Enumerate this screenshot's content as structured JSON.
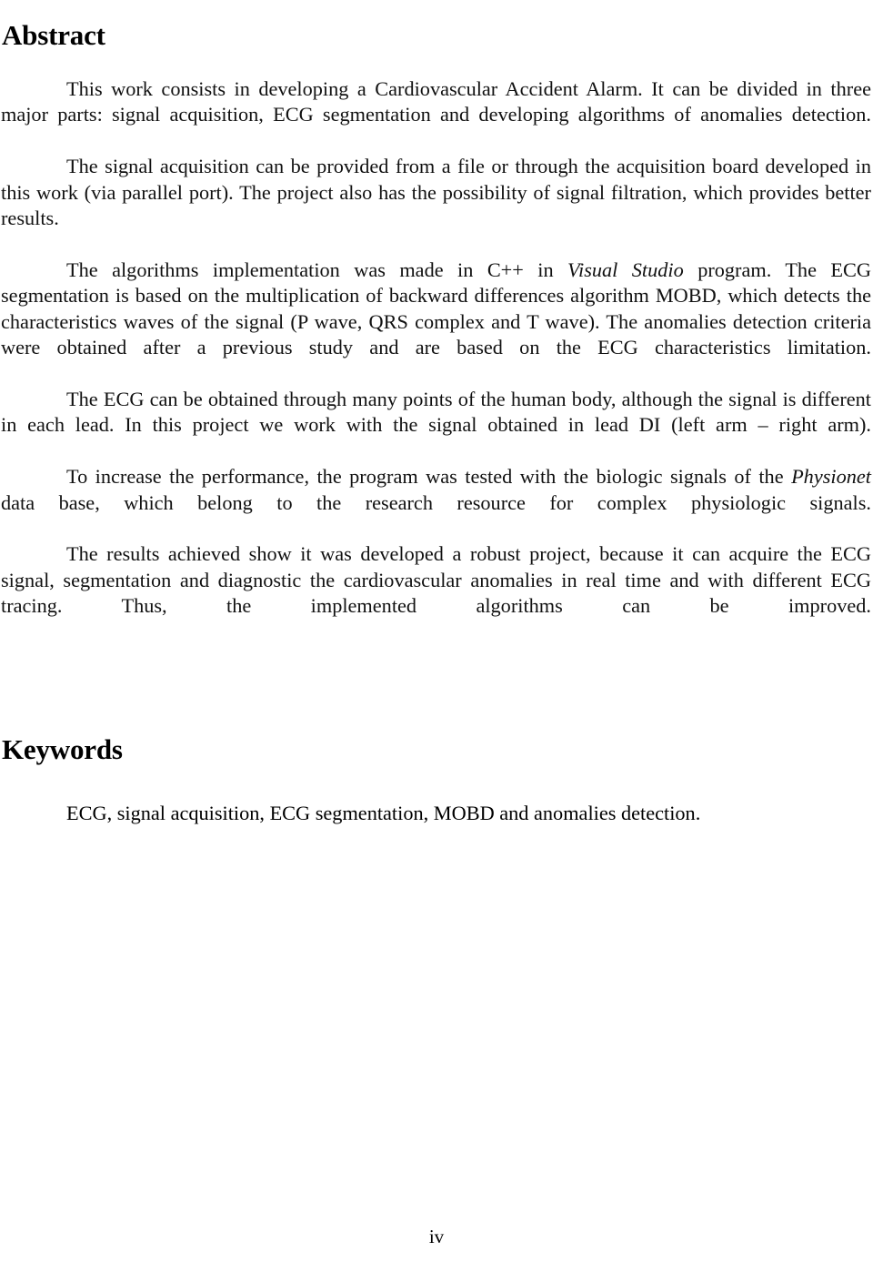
{
  "document": {
    "page_number": "iv",
    "sections": [
      {
        "heading": "Abstract",
        "paragraphs": [
          {
            "parts": [
              {
                "text": "This work consists in developing a Cardiovascular Accident Alarm. It can be divided in three major parts: signal acquisition, ECG segmentation and developing algorithms of anomalies detection.",
                "style": "normal"
              }
            ]
          },
          {
            "parts": [
              {
                "text": "The signal acquisition can be provided from a file or through the acquisition board developed in this work (via parallel port). The project also has the possibility of signal filtration, which provides better results.",
                "style": "normal"
              }
            ]
          },
          {
            "parts": [
              {
                "text": "The algorithms implementation was made in C++ in ",
                "style": "normal"
              },
              {
                "text": "Visual Studio",
                "style": "italic"
              },
              {
                "text": " program. The ECG segmentation is based on the multiplication of backward differences algorithm MOBD, which detects the characteristics waves of the signal (P wave, QRS complex and T wave). The anomalies detection criteria were obtained after a previous study and are based on the ECG characteristics limitation.",
                "style": "normal"
              }
            ]
          },
          {
            "parts": [
              {
                "text": "The ECG can be obtained through many points of the human body, although the signal is different in each lead. In this project we work with the signal obtained in lead DI (left arm – right arm).",
                "style": "normal"
              }
            ]
          },
          {
            "parts": [
              {
                "text": "To increase the performance, the program was tested with the biologic signals of the ",
                "style": "normal"
              },
              {
                "text": "Physionet",
                "style": "italic"
              },
              {
                "text": " data base, which belong to the research resource for complex physiologic signals.",
                "style": "normal"
              }
            ]
          },
          {
            "parts": [
              {
                "text": "The results achieved show it was developed a robust project, because it can acquire the ECG signal, segmentation and diagnostic the cardiovascular anomalies in real time and with different ECG tracing. Thus, the implemented algorithms can be improved.",
                "style": "normal"
              }
            ]
          }
        ]
      },
      {
        "heading": "Keywords",
        "paragraphs": [
          {
            "parts": [
              {
                "text": "ECG, signal acquisition, ECG segmentation, MOBD and anomalies detection.",
                "style": "normal"
              }
            ]
          }
        ]
      }
    ]
  }
}
